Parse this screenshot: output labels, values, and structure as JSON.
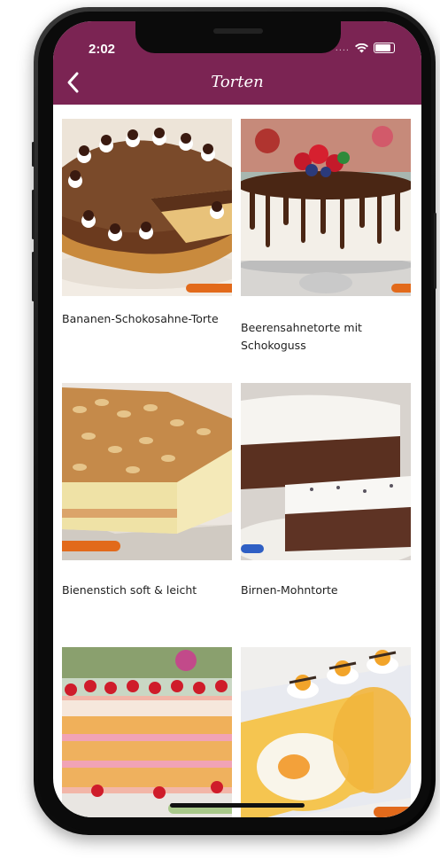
{
  "status_bar": {
    "time": "2:02",
    "signal": "....",
    "wifi_icon": "wifi-icon",
    "battery_icon": "battery-icon"
  },
  "header": {
    "title": "Torten",
    "back_icon": "chevron-left-icon"
  },
  "colors": {
    "header": "#7b2453"
  },
  "recipes": [
    {
      "name": "Bananen-Schokosahne-Torte"
    },
    {
      "name": "Beerensahnetorte mit Schokoguss"
    },
    {
      "name": "Bienenstich soft & leicht"
    },
    {
      "name": "Birnen-Mohntorte"
    }
  ]
}
